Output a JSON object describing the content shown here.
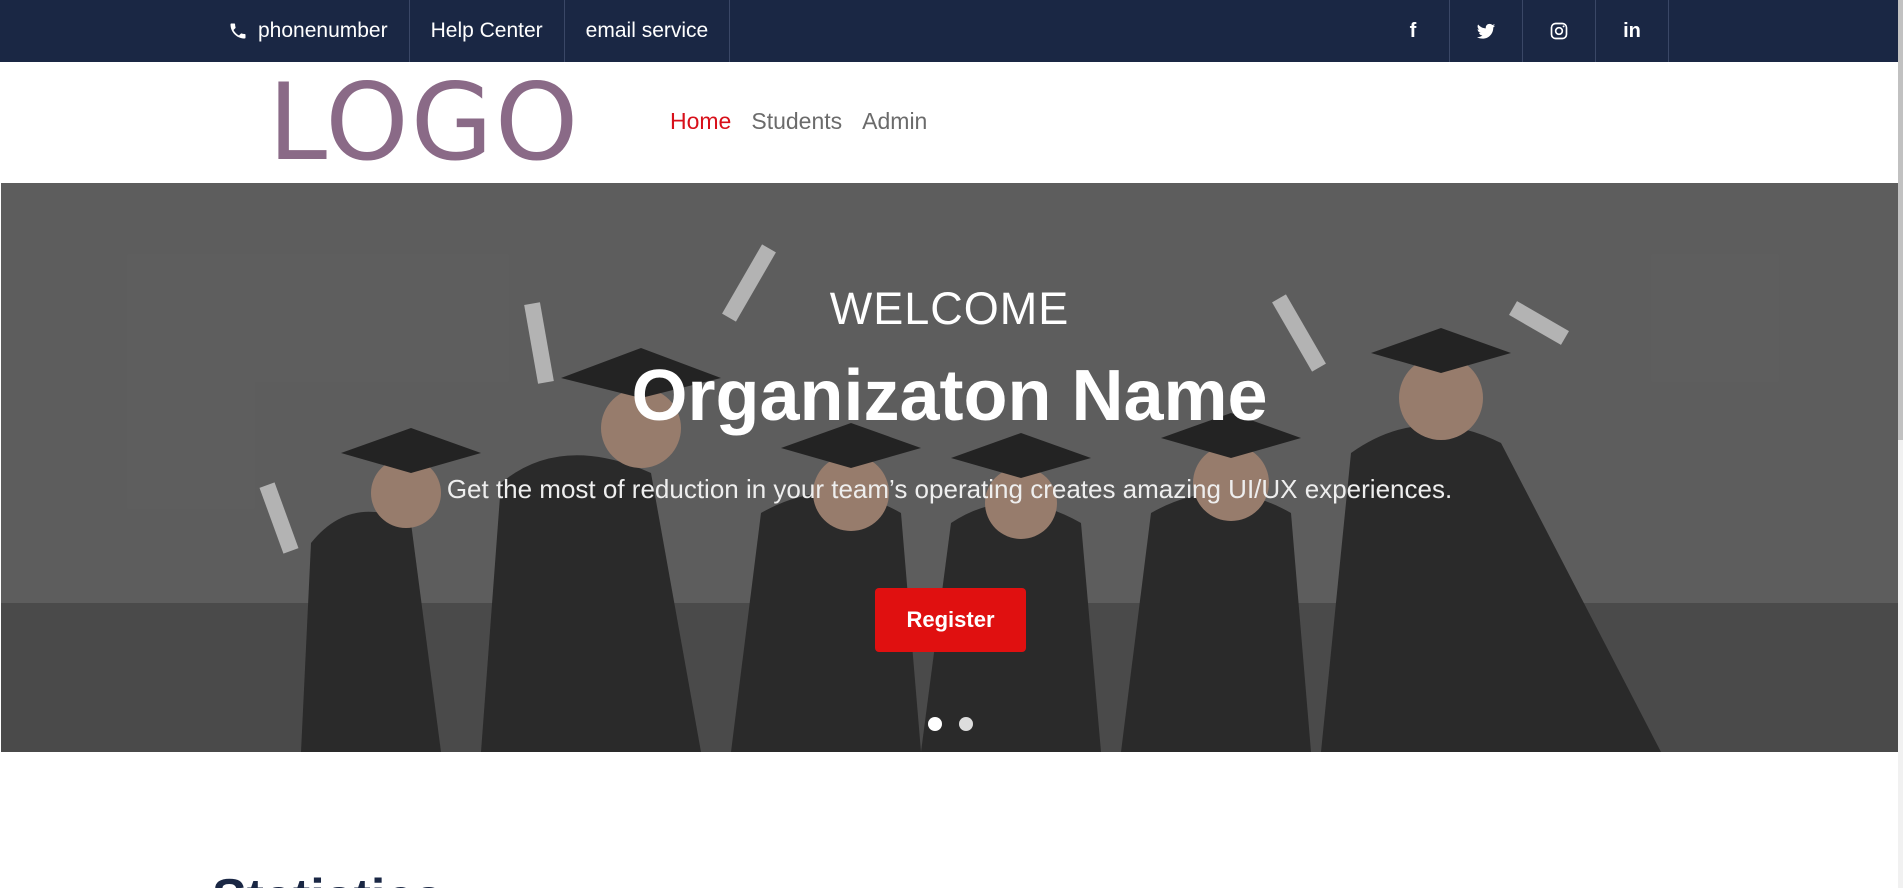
{
  "topbar": {
    "contacts": [
      {
        "label": "phonenumber",
        "icon": "phone-icon"
      },
      {
        "label": "Help Center"
      },
      {
        "label": "email service"
      }
    ],
    "social": [
      {
        "icon": "facebook-icon",
        "glyph": "f"
      },
      {
        "icon": "twitter-icon"
      },
      {
        "icon": "instagram-icon"
      },
      {
        "icon": "linkedin-icon",
        "glyph": "in"
      }
    ]
  },
  "header": {
    "logo": "LOGO",
    "nav": [
      {
        "label": "Home",
        "active": true
      },
      {
        "label": "Students",
        "active": false
      },
      {
        "label": "Admin",
        "active": false
      }
    ]
  },
  "hero": {
    "welcome": "WELCOME",
    "title": "Organizaton Name",
    "tagline": "Get the most of reduction in your team’s operating creates amazing UI/UX experiences.",
    "button": "Register",
    "slides": 2,
    "active_slide": 1
  },
  "section": {
    "heading": "Statistics"
  },
  "colors": {
    "topbar_bg": "#1a2744",
    "logo": "#8a6a87",
    "accent": "#e01010",
    "nav_active": "#d8101a"
  }
}
